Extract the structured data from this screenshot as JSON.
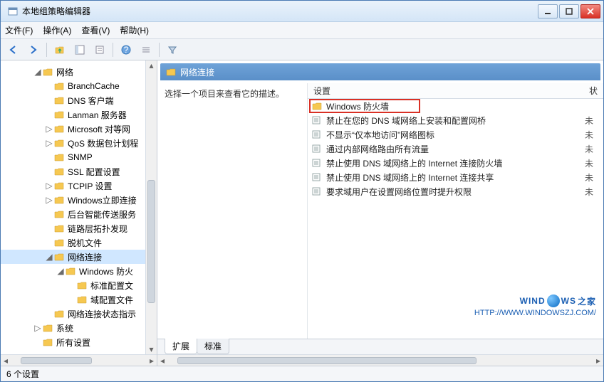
{
  "window": {
    "title": "本地组策略编辑器"
  },
  "menu": {
    "file": "文件(F)",
    "action": "操作(A)",
    "view": "查看(V)",
    "help": "帮助(H)"
  },
  "tree": [
    {
      "depth": 1,
      "expander": "◢",
      "icon": "folder",
      "label": "网络"
    },
    {
      "depth": 2,
      "expander": "",
      "icon": "folder",
      "label": "BranchCache"
    },
    {
      "depth": 2,
      "expander": "",
      "icon": "folder",
      "label": "DNS 客户端"
    },
    {
      "depth": 2,
      "expander": "",
      "icon": "folder",
      "label": "Lanman 服务器"
    },
    {
      "depth": 2,
      "expander": "▷",
      "icon": "folder",
      "label": "Microsoft 对等网"
    },
    {
      "depth": 2,
      "expander": "▷",
      "icon": "folder",
      "label": "QoS 数据包计划程"
    },
    {
      "depth": 2,
      "expander": "",
      "icon": "folder",
      "label": "SNMP"
    },
    {
      "depth": 2,
      "expander": "",
      "icon": "folder",
      "label": "SSL 配置设置"
    },
    {
      "depth": 2,
      "expander": "▷",
      "icon": "folder",
      "label": "TCPIP 设置"
    },
    {
      "depth": 2,
      "expander": "▷",
      "icon": "folder",
      "label": "Windows立即连接"
    },
    {
      "depth": 2,
      "expander": "",
      "icon": "folder",
      "label": "后台智能传送服务"
    },
    {
      "depth": 2,
      "expander": "",
      "icon": "folder",
      "label": "链路层拓扑发现"
    },
    {
      "depth": 2,
      "expander": "",
      "icon": "folder",
      "label": "脱机文件"
    },
    {
      "depth": 2,
      "expander": "◢",
      "icon": "folder",
      "label": "网络连接",
      "selected": true
    },
    {
      "depth": 3,
      "expander": "◢",
      "icon": "folder",
      "label": "Windows 防火"
    },
    {
      "depth": 4,
      "expander": "",
      "icon": "folder",
      "label": "标准配置文"
    },
    {
      "depth": 4,
      "expander": "",
      "icon": "folder",
      "label": "域配置文件"
    },
    {
      "depth": 2,
      "expander": "",
      "icon": "folder",
      "label": "网络连接状态指示"
    },
    {
      "depth": 1,
      "expander": "▷",
      "icon": "folder",
      "label": "系统"
    },
    {
      "depth": 1,
      "expander": "",
      "icon": "folder",
      "label": "所有设置"
    }
  ],
  "breadcrumb": "网络连接",
  "desc_hint": "选择一个项目来查看它的描述。",
  "list_header": {
    "name": "设置",
    "state": "状"
  },
  "list_rows": [
    {
      "icon": "folder",
      "name": "Windows 防火墙",
      "state": "",
      "highlighted": true
    },
    {
      "icon": "setting",
      "name": "禁止在您的 DNS 域网络上安装和配置网桥",
      "state": "未"
    },
    {
      "icon": "setting",
      "name": "不显示“仅本地访问”网络图标",
      "state": "未"
    },
    {
      "icon": "setting",
      "name": "通过内部网络路由所有流量",
      "state": "未"
    },
    {
      "icon": "setting",
      "name": "禁止使用 DNS 域网络上的 Internet 连接防火墙",
      "state": "未"
    },
    {
      "icon": "setting",
      "name": "禁止使用 DNS 域网络上的 Internet 连接共享",
      "state": "未"
    },
    {
      "icon": "setting",
      "name": "要求域用户在设置网络位置时提升权限",
      "state": "未"
    }
  ],
  "tabs": {
    "extended": "扩展",
    "standard": "标准"
  },
  "status": "6 个设置",
  "watermark": {
    "brand_a": "WIND",
    "brand_b": "WS",
    "brand_c": "之家",
    "url": "HTTP://WWW.WINDOWSZJ.COM/"
  }
}
